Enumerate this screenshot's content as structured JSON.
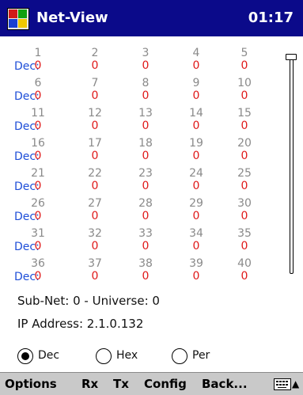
{
  "titlebar": {
    "title": "Net-View",
    "clock": "01:17"
  },
  "grid": {
    "rows": [
      {
        "label": "Dec:",
        "cells": [
          {
            "num": "1",
            "val": "0"
          },
          {
            "num": "2",
            "val": "0"
          },
          {
            "num": "3",
            "val": "0"
          },
          {
            "num": "4",
            "val": "0"
          },
          {
            "num": "5",
            "val": "0"
          }
        ]
      },
      {
        "label": "Dec:",
        "cells": [
          {
            "num": "6",
            "val": "0"
          },
          {
            "num": "7",
            "val": "0"
          },
          {
            "num": "8",
            "val": "0"
          },
          {
            "num": "9",
            "val": "0"
          },
          {
            "num": "10",
            "val": "0"
          }
        ]
      },
      {
        "label": "Dec:",
        "cells": [
          {
            "num": "11",
            "val": "0"
          },
          {
            "num": "12",
            "val": "0"
          },
          {
            "num": "13",
            "val": "0"
          },
          {
            "num": "14",
            "val": "0"
          },
          {
            "num": "15",
            "val": "0"
          }
        ]
      },
      {
        "label": "Dec:",
        "cells": [
          {
            "num": "16",
            "val": "0"
          },
          {
            "num": "17",
            "val": "0"
          },
          {
            "num": "18",
            "val": "0"
          },
          {
            "num": "19",
            "val": "0"
          },
          {
            "num": "20",
            "val": "0"
          }
        ]
      },
      {
        "label": "Dec:",
        "cells": [
          {
            "num": "21",
            "val": "0"
          },
          {
            "num": "22",
            "val": "0"
          },
          {
            "num": "23",
            "val": "0"
          },
          {
            "num": "24",
            "val": "0"
          },
          {
            "num": "25",
            "val": "0"
          }
        ]
      },
      {
        "label": "Dec:",
        "cells": [
          {
            "num": "26",
            "val": "0"
          },
          {
            "num": "27",
            "val": "0"
          },
          {
            "num": "28",
            "val": "0"
          },
          {
            "num": "29",
            "val": "0"
          },
          {
            "num": "30",
            "val": "0"
          }
        ]
      },
      {
        "label": "Dec:",
        "cells": [
          {
            "num": "31",
            "val": "0"
          },
          {
            "num": "32",
            "val": "0"
          },
          {
            "num": "33",
            "val": "0"
          },
          {
            "num": "34",
            "val": "0"
          },
          {
            "num": "35",
            "val": "0"
          }
        ]
      },
      {
        "label": "Dec:",
        "cells": [
          {
            "num": "36",
            "val": "0"
          },
          {
            "num": "37",
            "val": "0"
          },
          {
            "num": "38",
            "val": "0"
          },
          {
            "num": "39",
            "val": "0"
          },
          {
            "num": "40",
            "val": "0"
          }
        ]
      }
    ]
  },
  "info": {
    "subnet_line": "Sub-Net: 0  -  Universe: 0",
    "ip_line": "IP Address: 2.1.0.132"
  },
  "format": {
    "options": [
      {
        "label": "Dec",
        "checked": true
      },
      {
        "label": "Hex",
        "checked": false
      },
      {
        "label": "Per",
        "checked": false
      }
    ]
  },
  "menubar": {
    "items": [
      "Options",
      "Rx",
      "Tx",
      "Config",
      "Back..."
    ],
    "keyboard_icon": "keyboard-icon",
    "arrow_icon": "up-arrow-icon"
  },
  "colors": {
    "titlebar": "#0b0a8a",
    "row_label": "#1f4fd8",
    "channel_number": "#8a8a8a",
    "channel_value": "#e01818",
    "menubar": "#c9c9c9"
  }
}
